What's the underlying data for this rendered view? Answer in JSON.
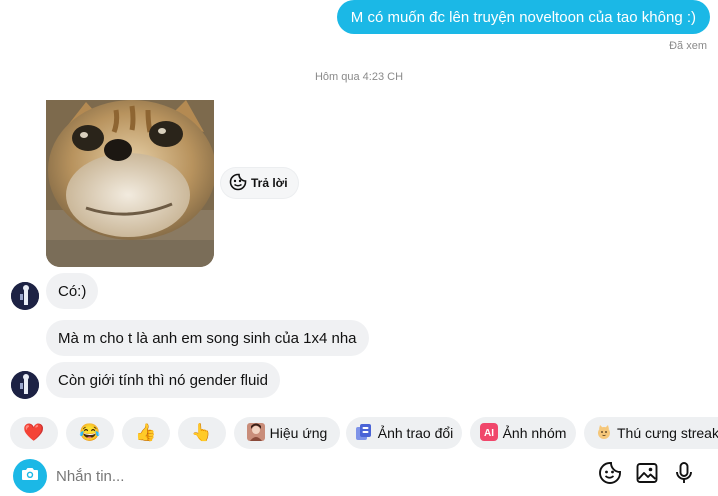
{
  "outgoing": {
    "text": "M có muốn đc lên truyện noveltoon của tao không :)",
    "status": "Đã xem"
  },
  "timestamp": "Hôm qua 4:23 CH",
  "sticker": {
    "reply_label": "Trả lời"
  },
  "incoming": [
    {
      "text": "Có:)"
    },
    {
      "text": "Mà m cho t là anh em song sinh của 1x4 nha"
    },
    {
      "text": "Còn giới tính thì nó gender fluid"
    }
  ],
  "quick_reactions": [
    {
      "emoji": "❤️",
      "icon": "heart-icon"
    },
    {
      "emoji": "😂",
      "icon": "laughing-face-icon"
    },
    {
      "emoji": "👍",
      "icon": "thumbs-up-icon"
    },
    {
      "emoji": "👆",
      "icon": "pointing-up-icon"
    }
  ],
  "quick_actions": [
    {
      "label": "Hiệu ứng",
      "icon": "effects-thumbnail-icon"
    },
    {
      "label": "Ảnh trao đổi",
      "icon": "photo-exchange-icon"
    },
    {
      "label": "Ảnh nhóm",
      "icon": "ai-icon"
    },
    {
      "label": "Thú cưng streak",
      "icon": "pet-icon"
    }
  ],
  "composer": {
    "placeholder": "Nhắn tin..."
  },
  "colors": {
    "accent": "#1bb8e6",
    "bubble_in": "#f0f1f3",
    "chip": "#eef0f2"
  }
}
